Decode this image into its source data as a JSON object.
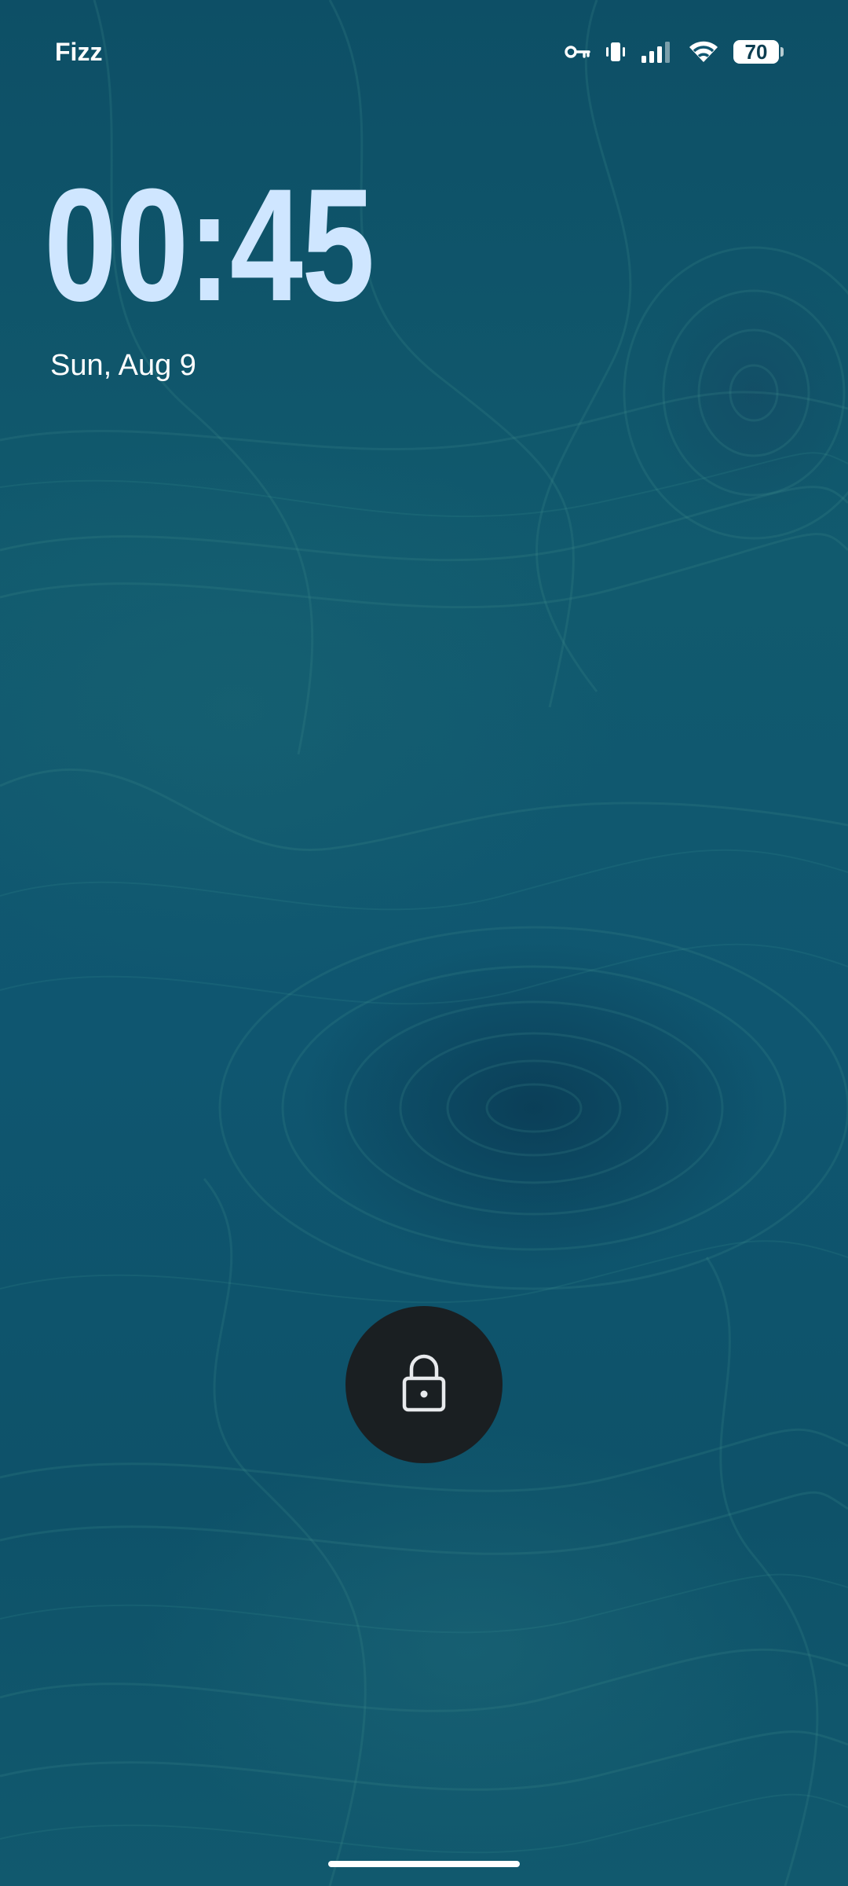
{
  "status_bar": {
    "carrier": "Fizz",
    "battery_level": "70",
    "battery_percent": 70,
    "icons": [
      "vpn-key-icon",
      "vibrate-icon",
      "cell-signal-icon",
      "wifi-icon",
      "battery-icon"
    ]
  },
  "lock_screen": {
    "time": "00:45",
    "date": "Sun, Aug 9",
    "lock_icon": "lock-icon"
  },
  "colors": {
    "clock": "#cfe6ff",
    "lock_button_bg": "#1a1f22",
    "wallpaper_base": "#0f5670"
  }
}
